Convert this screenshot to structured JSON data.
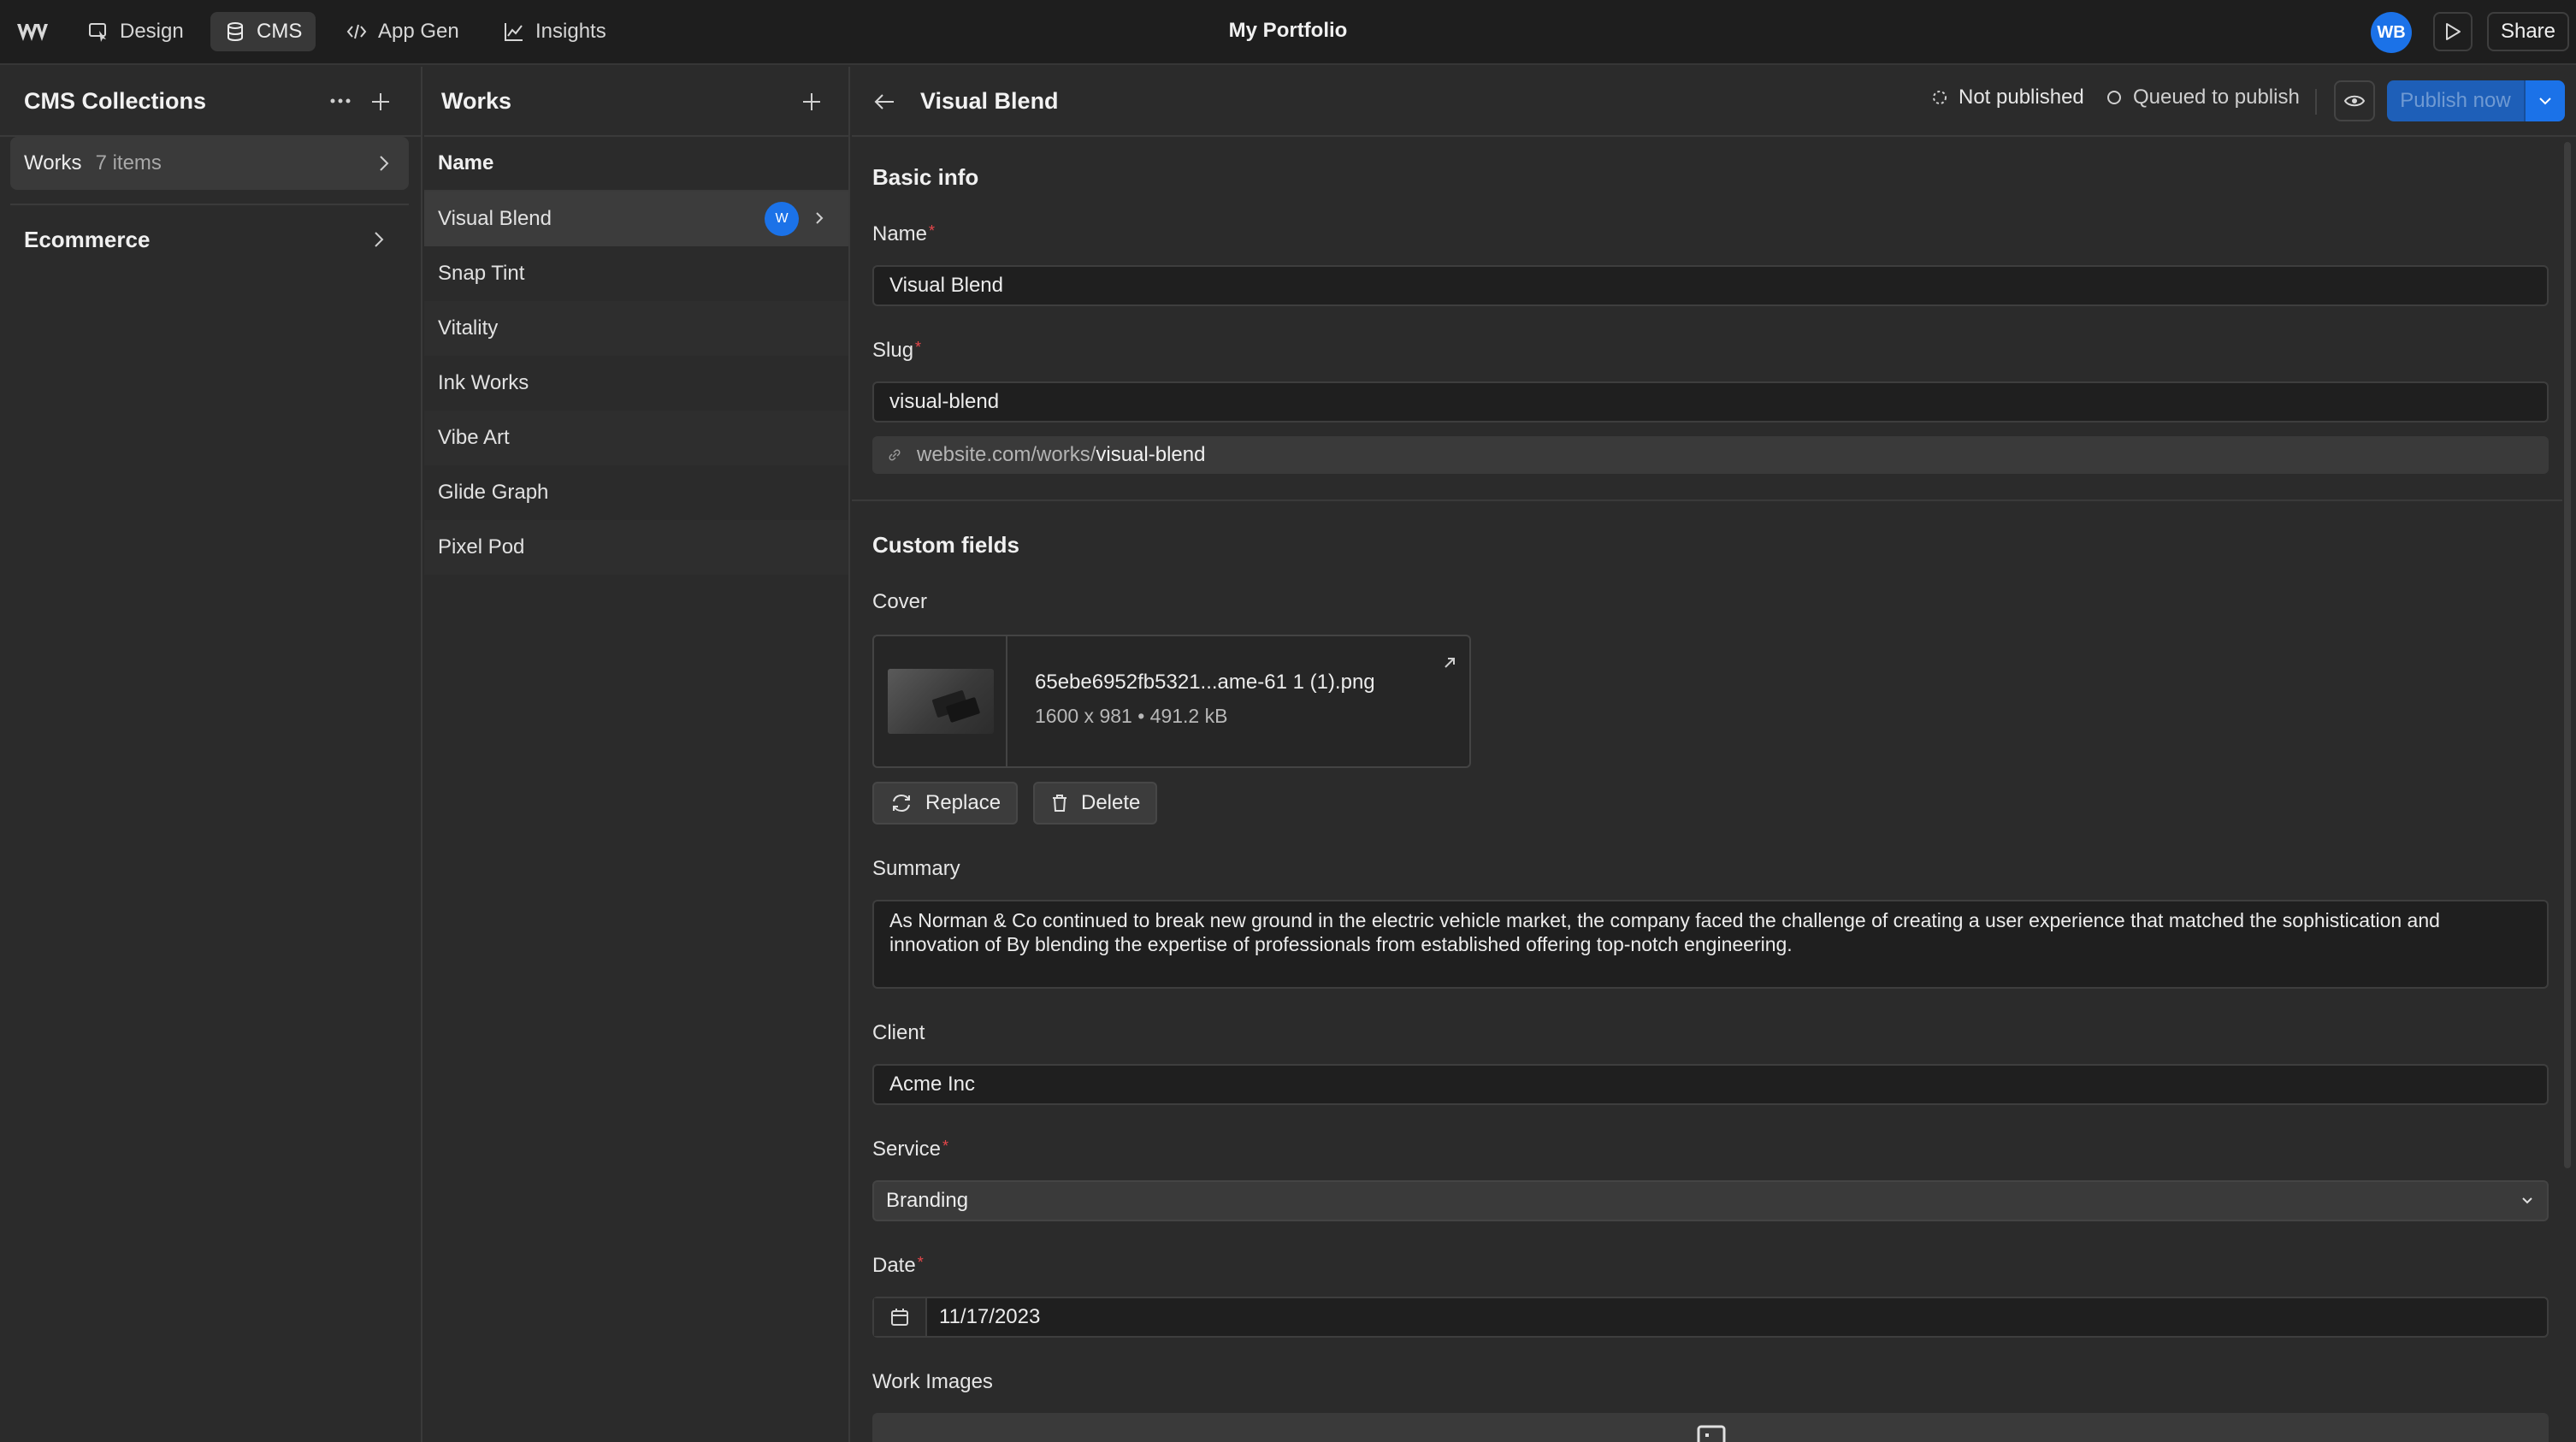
{
  "topbar": {
    "tabs": [
      {
        "label": "Design",
        "icon": "design-icon"
      },
      {
        "label": "CMS",
        "icon": "database-icon"
      },
      {
        "label": "App Gen",
        "icon": "code-icon"
      },
      {
        "label": "Insights",
        "icon": "chart-icon"
      }
    ],
    "title": "My Portfolio",
    "avatar": "WB",
    "share_label": "Share",
    "accent": "#1b72e8"
  },
  "collections": {
    "title": "CMS Collections",
    "items": [
      {
        "name": "Works",
        "count": "7 items"
      }
    ],
    "ecommerce_label": "Ecommerce"
  },
  "works": {
    "title": "Works",
    "column_header": "Name",
    "items": [
      "Visual Blend",
      "Snap Tint",
      "Vitality",
      "Ink Works",
      "Vibe Art",
      "Glide Graph",
      "Pixel Pod"
    ],
    "selected_avatar": "W"
  },
  "editor": {
    "title": "Visual Blend",
    "status_not_published": "Not published",
    "status_queued": "Queued to publish",
    "publish_label": "Publish now",
    "basic_info": {
      "title": "Basic info",
      "name_label": "Name",
      "name_value": "Visual Blend",
      "slug_label": "Slug",
      "slug_value": "visual-blend",
      "url_prefix": "website.com/works/",
      "url_slug": "visual-blend"
    },
    "custom_fields": {
      "title": "Custom fields",
      "cover_label": "Cover",
      "cover_file": "65ebe6952fb5321...ame-61 1 (1).png",
      "cover_meta": "1600 x 981 • 491.2 kB",
      "replace_label": "Replace",
      "delete_label": "Delete",
      "summary_label": "Summary",
      "summary_value": "As Norman & Co continued to break new ground in the electric vehicle market, the company faced the challenge of creating a user experience that matched the sophistication and innovation of By blending the expertise of professionals from established offering top-notch engineering.",
      "client_label": "Client",
      "client_value": "Acme Inc",
      "service_label": "Service",
      "service_value": "Branding",
      "date_label": "Date",
      "date_value": "11/17/2023",
      "work_images_label": "Work Images"
    }
  }
}
